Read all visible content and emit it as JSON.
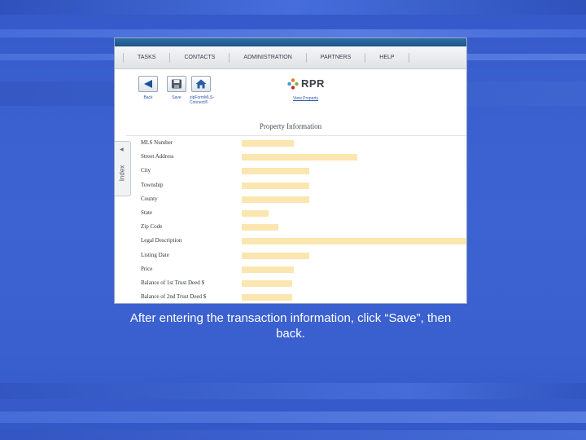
{
  "nav": [
    "TASKS",
    "CONTACTS",
    "ADMINISTRATION",
    "PARTNERS",
    "HELP"
  ],
  "toolbar": {
    "back_label": "Back",
    "save_label": "Save",
    "zip_label_1": "zipFormMLS-",
    "zip_label_2": "Connect®"
  },
  "rpr": {
    "logo_text": "RPR",
    "view_property": "View Property"
  },
  "section_title": "Property Information",
  "index_tab": "Index",
  "fields": [
    {
      "label": "MLS Number"
    },
    {
      "label": "Street Address"
    },
    {
      "label": "City"
    },
    {
      "label": "Township"
    },
    {
      "label": "County"
    },
    {
      "label": "State"
    },
    {
      "label": "Zip Code"
    },
    {
      "label": "Legal Description"
    },
    {
      "label": "Listing Date"
    },
    {
      "label": "Price"
    },
    {
      "label": "Balance of 1st Trust Deed $"
    },
    {
      "label": "Balance of 2nd Trust Deed $"
    }
  ],
  "caption": "After entering the transaction information, click “Save”, then back.",
  "colors": {
    "field_highlight": "#fbe6b0",
    "link": "#2b57a8",
    "background": "#3d63d2"
  }
}
